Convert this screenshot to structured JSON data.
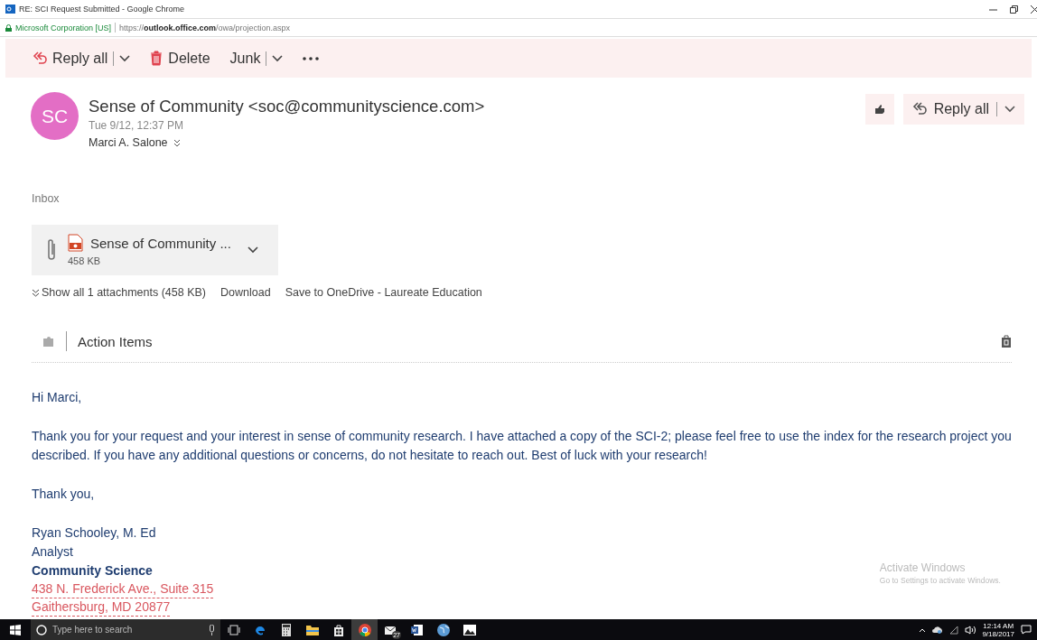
{
  "window": {
    "title": "RE: SCI Request Submitted - Google Chrome"
  },
  "address_bar": {
    "security": "Microsoft Corporation [US]",
    "url": "https://**outlook.office.com**/owa/projection.aspx"
  },
  "toolbar": [
    {
      "kind": "reply_all",
      "label": "Reply all"
    },
    {
      "kind": "delete",
      "label": "Delete"
    },
    {
      "kind": "junk",
      "label": "Junk"
    },
    {
      "kind": "more"
    }
  ],
  "message": {
    "avatar": "SC",
    "sender": "Sense of Community <soc@communityscience.com>",
    "date": "Tue 9/12, 12:37 PM",
    "to": "Marci A. Salone",
    "reply_button": "Reply all",
    "folder": "Inbox"
  },
  "attachment": {
    "name": "Sense of Community ...",
    "size": "458 KB"
  },
  "attachment_links": [
    "Show all 1 attachments (458 KB)",
    "Download",
    "Save to OneDrive - Laureate Education"
  ],
  "action_items": {
    "label": "Action Items"
  },
  "body": {
    "greeting": "Hi Marci,",
    "paragraph": "Thank you for your request and your interest in sense of community research. I have attached a copy of the SCI-2; please feel free to use the index for the research project you described. If you have any additional questions or concerns, do not hesitate to reach out. Best of luck with your research!",
    "closing": "Thank you,",
    "signature": [
      {
        "kind": "plain",
        "text": "Ryan Schooley, M. Ed"
      },
      {
        "kind": "plain",
        "text": "Analyst"
      },
      {
        "kind": "bold",
        "text": "Community Science"
      },
      {
        "kind": "address",
        "text": "438 N. Frederick Ave., Suite 315"
      },
      {
        "kind": "address",
        "text": "Gaithersburg, MD 20877"
      }
    ]
  },
  "activation": {
    "title": "Activate Windows",
    "subtitle": "Go to Settings to activate Windows."
  },
  "taskbar": {
    "search_placeholder": "Type here to search",
    "apps": [
      {
        "kind": "edge",
        "selected": false
      },
      {
        "kind": "calculator",
        "selected": false
      },
      {
        "kind": "folder",
        "selected": false
      },
      {
        "kind": "store",
        "selected": false
      },
      {
        "kind": "chrome",
        "selected": true
      },
      {
        "kind": "mail",
        "selected": false,
        "badge": "27"
      },
      {
        "kind": "word",
        "selected": false
      },
      {
        "kind": "globe",
        "selected": false
      },
      {
        "kind": "photos",
        "selected": false
      }
    ],
    "time": "12:14 AM",
    "date": "9/18/2017"
  }
}
